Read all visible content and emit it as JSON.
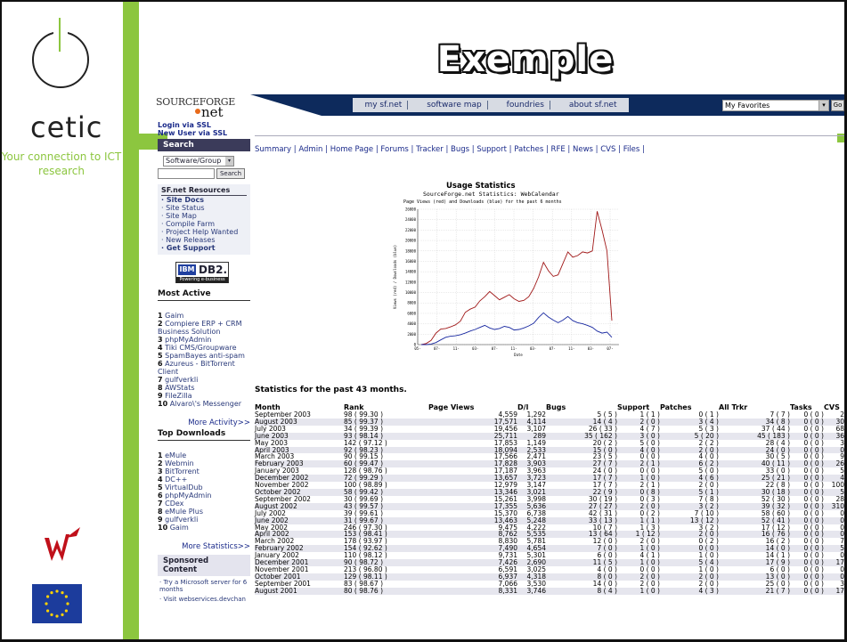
{
  "slide": {
    "title": "Exemple",
    "brand": "cetic",
    "tagline": "Your connection to ICT research",
    "colors": {
      "green": "#8cc63f",
      "navy": "#0d2a5c"
    }
  },
  "sf": {
    "logo_top": "SOURCEFORGE",
    "logo_net": "net",
    "nav": [
      "my sf.net",
      "software map",
      "foundries",
      "about sf.net"
    ],
    "favorites": "My Favorites",
    "go": "Go"
  },
  "sidebar": {
    "login_ssl": "Login via SSL",
    "new_user": "New User via SSL",
    "search_title": "Search",
    "search_scope": "Software/Group",
    "search_button": "Search",
    "resources_title": "SF.net Resources",
    "resources": [
      "· Site Docs",
      "· Site Status",
      "· Site Map",
      "· Compile Farm",
      "· Project Help Wanted",
      "· New Releases",
      "· Get Support"
    ],
    "ibm": {
      "a": "IBM",
      "b": "DB2.",
      "c": "Powering e-business"
    },
    "most_active_title": "Most Active",
    "most_active": [
      {
        "n": "1",
        "name": "Gaim"
      },
      {
        "n": "2",
        "name": "Compiere ERP + CRM Business Solution"
      },
      {
        "n": "3",
        "name": "phpMyAdmin"
      },
      {
        "n": "4",
        "name": "Tiki CMS/Groupware"
      },
      {
        "n": "5",
        "name": "SpamBayes anti-spam"
      },
      {
        "n": "6",
        "name": "Azureus - BitTorrent Client"
      },
      {
        "n": "7",
        "name": "gulfverkli"
      },
      {
        "n": "8",
        "name": "AWStats"
      },
      {
        "n": "9",
        "name": "FileZilla"
      },
      {
        "n": "10",
        "name": "Alvaro\\'s Messenger"
      }
    ],
    "more_activity": "More Activity>>",
    "top_downloads_title": "Top Downloads",
    "top_downloads": [
      {
        "n": "1",
        "name": "eMule"
      },
      {
        "n": "2",
        "name": "Webmin"
      },
      {
        "n": "3",
        "name": "BitTorrent"
      },
      {
        "n": "4",
        "name": "DC++"
      },
      {
        "n": "5",
        "name": "VirtualDub"
      },
      {
        "n": "6",
        "name": "phpMyAdmin"
      },
      {
        "n": "7",
        "name": "CDex"
      },
      {
        "n": "8",
        "name": "eMule Plus"
      },
      {
        "n": "9",
        "name": "gulfverkli"
      },
      {
        "n": "10",
        "name": "Gaim"
      }
    ],
    "more_statistics": "More Statistics>>",
    "sponsored_title": "Sponsored Content",
    "sponsored": [
      "· Try a Microsoft server for 6 months",
      "· Visit webservices.devchan"
    ]
  },
  "tabs": [
    "Summary",
    "Admin",
    "Home Page",
    "Forums",
    "Tracker",
    "Bugs",
    "Support",
    "Patches",
    "RFE",
    "News",
    "CVS",
    "Files"
  ],
  "usage": {
    "title": "Usage Statistics",
    "subtitle": "SourceForge.net Statistics: WebCalendar",
    "note": "Page Views (red) and Downloads (blue) for the past 6 months"
  },
  "chart_data": {
    "type": "line",
    "xlabel": "Date",
    "ylabel": "Views (red) / Downloads (blue)",
    "ylim": [
      0,
      26000
    ],
    "y_ticks": [
      "0",
      "2000",
      "4000",
      "6000",
      "8000",
      "10000",
      "12000",
      "14000",
      "16000",
      "18000",
      "20000",
      "22000",
      "24000",
      "26000"
    ],
    "x_ticks": [
      "05-",
      "07-",
      "11-",
      "03-",
      "07-",
      "11-",
      "03-",
      "07-",
      "11-",
      "03-",
      "07-"
    ],
    "series": [
      {
        "name": "Page Views",
        "color": "#a01818",
        "values": [
          0,
          200,
          800,
          2200,
          3000,
          3100,
          3400,
          3800,
          4500,
          6200,
          6800,
          7200,
          8400,
          9200,
          10200,
          9400,
          8600,
          9100,
          9600,
          8800,
          8300,
          8500,
          9200,
          10800,
          13000,
          15800,
          14200,
          13100,
          13400,
          15600,
          17800,
          16800,
          17100,
          17800,
          17600,
          18000,
          25600,
          22000,
          18000,
          4600
        ]
      },
      {
        "name": "Downloads",
        "color": "#1828a0",
        "values": [
          0,
          0,
          100,
          400,
          900,
          1400,
          1600,
          1700,
          1900,
          2200,
          2600,
          2900,
          3300,
          3700,
          3200,
          2900,
          3100,
          3500,
          3300,
          2800,
          2900,
          3200,
          3600,
          4100,
          5200,
          6100,
          5300,
          4700,
          4200,
          4700,
          5400,
          4600,
          4200,
          4000,
          3700,
          3300,
          2600,
          2200,
          2400,
          1400
        ]
      }
    ]
  },
  "stats": {
    "heading": "Statistics for the past 43 months.",
    "columns": [
      "Month",
      "Rank",
      "Page Views",
      "D/l",
      "Bugs",
      "Support",
      "Patches",
      "All Trkr",
      "Tasks",
      "CVS"
    ],
    "rows": [
      [
        "September 2003",
        "98 ( 99.30 )",
        "4,559",
        "1,292",
        "5 ( 5 )",
        "1 ( 1 )",
        "0 ( 1 )",
        "7 ( 7 )",
        "0 ( 0 )",
        "2"
      ],
      [
        "August 2003",
        "85 ( 99.37 )",
        "17,571",
        "4,114",
        "14 ( 4 )",
        "2 ( 0 )",
        "3 ( 4 )",
        "34 ( 8 )",
        "0 ( 0 )",
        "30"
      ],
      [
        "July 2003",
        "34 ( 99.39 )",
        "19,456",
        "3,107",
        "26 ( 33 )",
        "4 ( 7 )",
        "5 ( 3 )",
        "37 ( 44 )",
        "0 ( 0 )",
        "68"
      ],
      [
        "June 2003",
        "93 ( 98.14 )",
        "25,711",
        "289",
        "35 ( 162 )",
        "3 ( 0 )",
        "5 ( 20 )",
        "45 ( 183 )",
        "0 ( 0 )",
        "36"
      ],
      [
        "May 2003",
        "142 ( 97.12 )",
        "17,853",
        "1,149",
        "20 ( 2 )",
        "5 ( 0 )",
        "2 ( 2 )",
        "28 ( 4 )",
        "0 ( 0 )",
        "3"
      ],
      [
        "April 2003",
        "92 ( 98.23 )",
        "18,094",
        "2,533",
        "15 ( 0 )",
        "4 ( 0 )",
        "2 ( 0 )",
        "24 ( 0 )",
        "0 ( 0 )",
        "0"
      ],
      [
        "March 2003",
        "90 ( 99.15 )",
        "17,566",
        "2,471",
        "23 ( 5 )",
        "0 ( 0 )",
        "4 ( 0 )",
        "30 ( 5 )",
        "0 ( 0 )",
        "9"
      ],
      [
        "February 2003",
        "60 ( 99.47 )",
        "17,828",
        "3,903",
        "27 ( 7 )",
        "2 ( 1 )",
        "6 ( 2 )",
        "40 ( 11 )",
        "0 ( 0 )",
        "26"
      ],
      [
        "January 2003",
        "128 ( 98.76 )",
        "17,187",
        "3,963",
        "24 ( 0 )",
        "0 ( 0 )",
        "5 ( 0 )",
        "33 ( 0 )",
        "0 ( 0 )",
        "5"
      ],
      [
        "December 2002",
        "72 ( 99.29 )",
        "13,657",
        "3,723",
        "17 ( 7 )",
        "1 ( 0 )",
        "4 ( 6 )",
        "25 ( 21 )",
        "0 ( 0 )",
        "4"
      ],
      [
        "November 2002",
        "100 ( 98.89 )",
        "12,979",
        "3,147",
        "17 ( 7 )",
        "2 ( 1 )",
        "2 ( 0 )",
        "22 ( 8 )",
        "0 ( 0 )",
        "100"
      ],
      [
        "October 2002",
        "58 ( 99.42 )",
        "13,346",
        "3,021",
        "22 ( 9 )",
        "0 ( 8 )",
        "5 ( 1 )",
        "30 ( 18 )",
        "0 ( 0 )",
        "5"
      ],
      [
        "September 2002",
        "30 ( 99.69 )",
        "15,261",
        "3,998",
        "30 ( 19 )",
        "0 ( 3 )",
        "7 ( 8 )",
        "52 ( 30 )",
        "0 ( 0 )",
        "28"
      ],
      [
        "August 2002",
        "43 ( 99.57 )",
        "17,355",
        "5,636",
        "27 ( 27 )",
        "2 ( 0 )",
        "3 ( 2 )",
        "39 ( 32 )",
        "0 ( 0 )",
        "310"
      ],
      [
        "July 2002",
        "39 ( 99.61 )",
        "15,370",
        "6,738",
        "42 ( 31 )",
        "0 ( 2 )",
        "7 ( 10 )",
        "58 ( 60 )",
        "0 ( 0 )",
        "0"
      ],
      [
        "June 2002",
        "31 ( 99.67 )",
        "13,463",
        "5,248",
        "33 ( 13 )",
        "1 ( 1 )",
        "13 ( 12 )",
        "52 ( 41 )",
        "0 ( 0 )",
        "0"
      ],
      [
        "May 2002",
        "246 ( 97.30 )",
        "9,475",
        "4,222",
        "10 ( 7 )",
        "1 ( 3 )",
        "3 ( 2 )",
        "17 ( 12 )",
        "0 ( 0 )",
        "0"
      ],
      [
        "April 2002",
        "153 ( 98.41 )",
        "8,762",
        "5,535",
        "13 ( 64 )",
        "1 ( 12 )",
        "2 ( 0 )",
        "16 ( 76 )",
        "0 ( 0 )",
        "0"
      ],
      [
        "March 2002",
        "178 ( 93.97 )",
        "8,830",
        "5,781",
        "12 ( 0 )",
        "2 ( 0 )",
        "0 ( 2 )",
        "16 ( 2 )",
        "0 ( 0 )",
        "7"
      ],
      [
        "February 2002",
        "154 ( 92.62 )",
        "7,490",
        "4,654",
        "7 ( 0 )",
        "1 ( 0 )",
        "0 ( 0 )",
        "14 ( 0 )",
        "0 ( 0 )",
        "5"
      ],
      [
        "January 2002",
        "110 ( 98.12 )",
        "9,731",
        "5,301",
        "6 ( 0 )",
        "4 ( 1 )",
        "1 ( 0 )",
        "14 ( 1 )",
        "0 ( 0 )",
        "0"
      ],
      [
        "December 2001",
        "90 ( 98.72 )",
        "7,426",
        "2,690",
        "11 ( 5 )",
        "1 ( 0 )",
        "5 ( 4 )",
        "17 ( 9 )",
        "0 ( 0 )",
        "17"
      ],
      [
        "November 2001",
        "213 ( 96.80 )",
        "6,591",
        "3,025",
        "4 ( 0 )",
        "0 ( 0 )",
        "1 ( 0 )",
        "6 ( 0 )",
        "0 ( 0 )",
        "0"
      ],
      [
        "October 2001",
        "129 ( 98.11 )",
        "6,937",
        "4,318",
        "8 ( 0 )",
        "2 ( 0 )",
        "2 ( 0 )",
        "13 ( 0 )",
        "0 ( 0 )",
        "0"
      ],
      [
        "September 2001",
        "83 ( 98.67 )",
        "7,066",
        "3,530",
        "14 ( 0 )",
        "2 ( 0 )",
        "2 ( 0 )",
        "25 ( 0 )",
        "0 ( 0 )",
        "3"
      ],
      [
        "August 2001",
        "80 ( 98.76 )",
        "8,331",
        "3,746",
        "8 ( 4 )",
        "1 ( 0 )",
        "4 ( 3 )",
        "21 ( 7 )",
        "0 ( 0 )",
        "17"
      ]
    ]
  }
}
